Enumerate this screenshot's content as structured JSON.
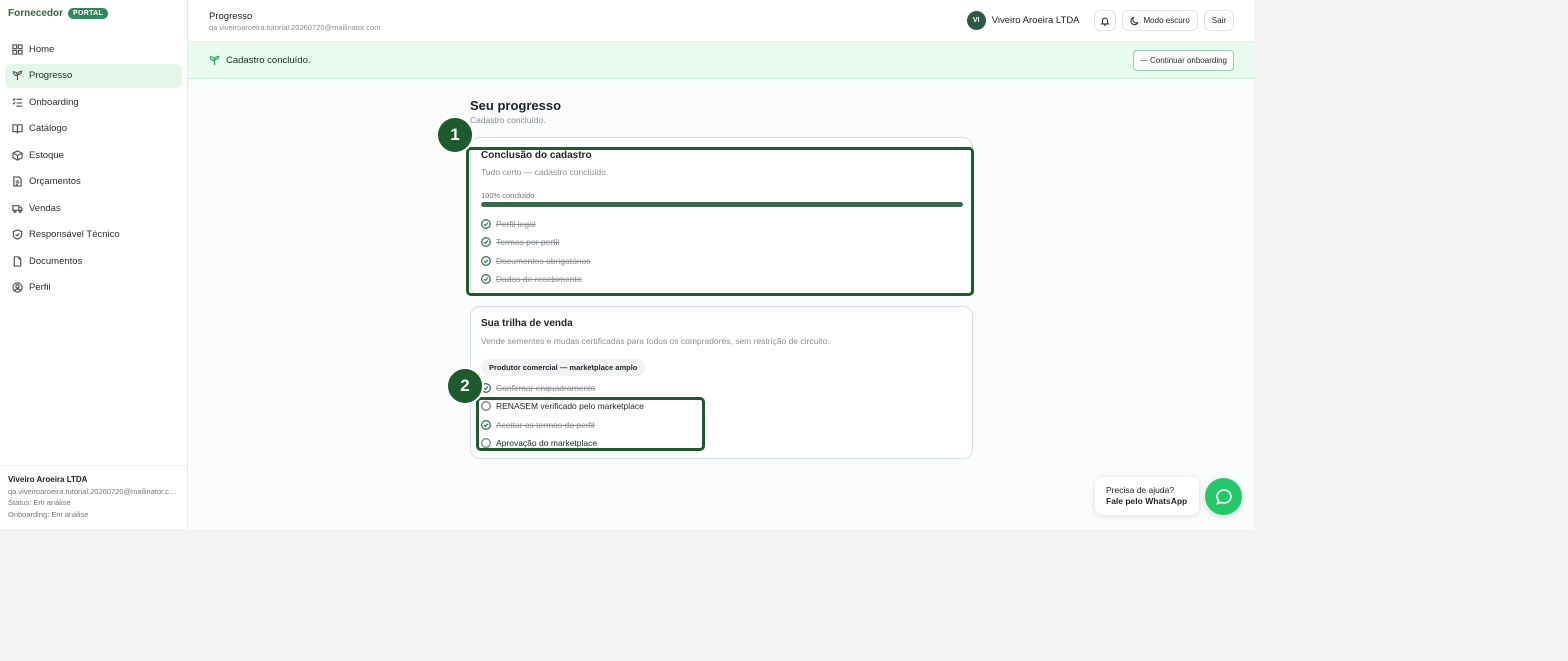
{
  "brand": {
    "name": "Fornecedor",
    "badge": "PORTAL"
  },
  "sidebar": {
    "items": [
      {
        "label": "Home",
        "icon": "grid-icon"
      },
      {
        "label": "Progresso",
        "icon": "sprout-icon"
      },
      {
        "label": "Onboarding",
        "icon": "checklist-icon"
      },
      {
        "label": "Catálogo",
        "icon": "book-icon"
      },
      {
        "label": "Estoque",
        "icon": "box-icon"
      },
      {
        "label": "Orçamentos",
        "icon": "document-icon"
      },
      {
        "label": "Vendas",
        "icon": "truck-icon"
      },
      {
        "label": "Responsável Técnico",
        "icon": "shield-icon"
      },
      {
        "label": "Documentos",
        "icon": "file-icon"
      },
      {
        "label": "Perfil",
        "icon": "user-icon"
      }
    ],
    "active_index": 1,
    "footer": {
      "name": "Viveiro Aroeira LTDA",
      "email": "qa.viveiroaroeira.tutorial.20260720@mailinator.com",
      "status": "Status: Em análise",
      "onboarding": "Onboarding: Em análise"
    }
  },
  "header": {
    "title": "Progresso",
    "subtitle": "qa.viveiroaroeira.tutorial.20260720@mailinator.com",
    "avatar_initials": "VI",
    "company": "Viveiro Aroeira LTDA",
    "dark_mode_label": "Modo escuro",
    "logout_label": "Sair"
  },
  "banner": {
    "text": "Cadastro concluído.",
    "button_label": "— Continuar onboarding"
  },
  "main": {
    "title": "Seu progresso",
    "subtitle": "Cadastro concluído."
  },
  "completion_card": {
    "title": "Conclusão do cadastro",
    "description": "Tudo certo — cadastro concluído.",
    "progress_label": "100% concluído",
    "progress_percent": 100,
    "items": [
      {
        "label": "Perfil legal",
        "done": true
      },
      {
        "label": "Termos por perfil",
        "done": true
      },
      {
        "label": "Documentos obrigatórios",
        "done": true
      },
      {
        "label": "Dados de recebimento",
        "done": true
      }
    ]
  },
  "trail_card": {
    "title": "Sua trilha de venda",
    "description": "Vende sementes e mudas certificadas para todos os compradores, sem restrição de circuito.",
    "chip": "Produtor comercial — marketplace amplo",
    "items": [
      {
        "label": "Confirmar enquadramento",
        "done": true
      },
      {
        "label": "RENASEM verificado pelo marketplace",
        "done": false
      },
      {
        "label": "Aceitar os termos do perfil",
        "done": true
      },
      {
        "label": "Aprovação do marketplace",
        "done": false
      }
    ]
  },
  "annotations": {
    "marker1": "1",
    "marker2": "2"
  },
  "help": {
    "line1": "Precisa de ajuda?",
    "line2": "Fale pelo WhatsApp"
  },
  "colors": {
    "brand": "#2e8b57",
    "annotation": "#1e5b2c",
    "whatsapp": "#25c868",
    "progress": "#356a4e"
  }
}
